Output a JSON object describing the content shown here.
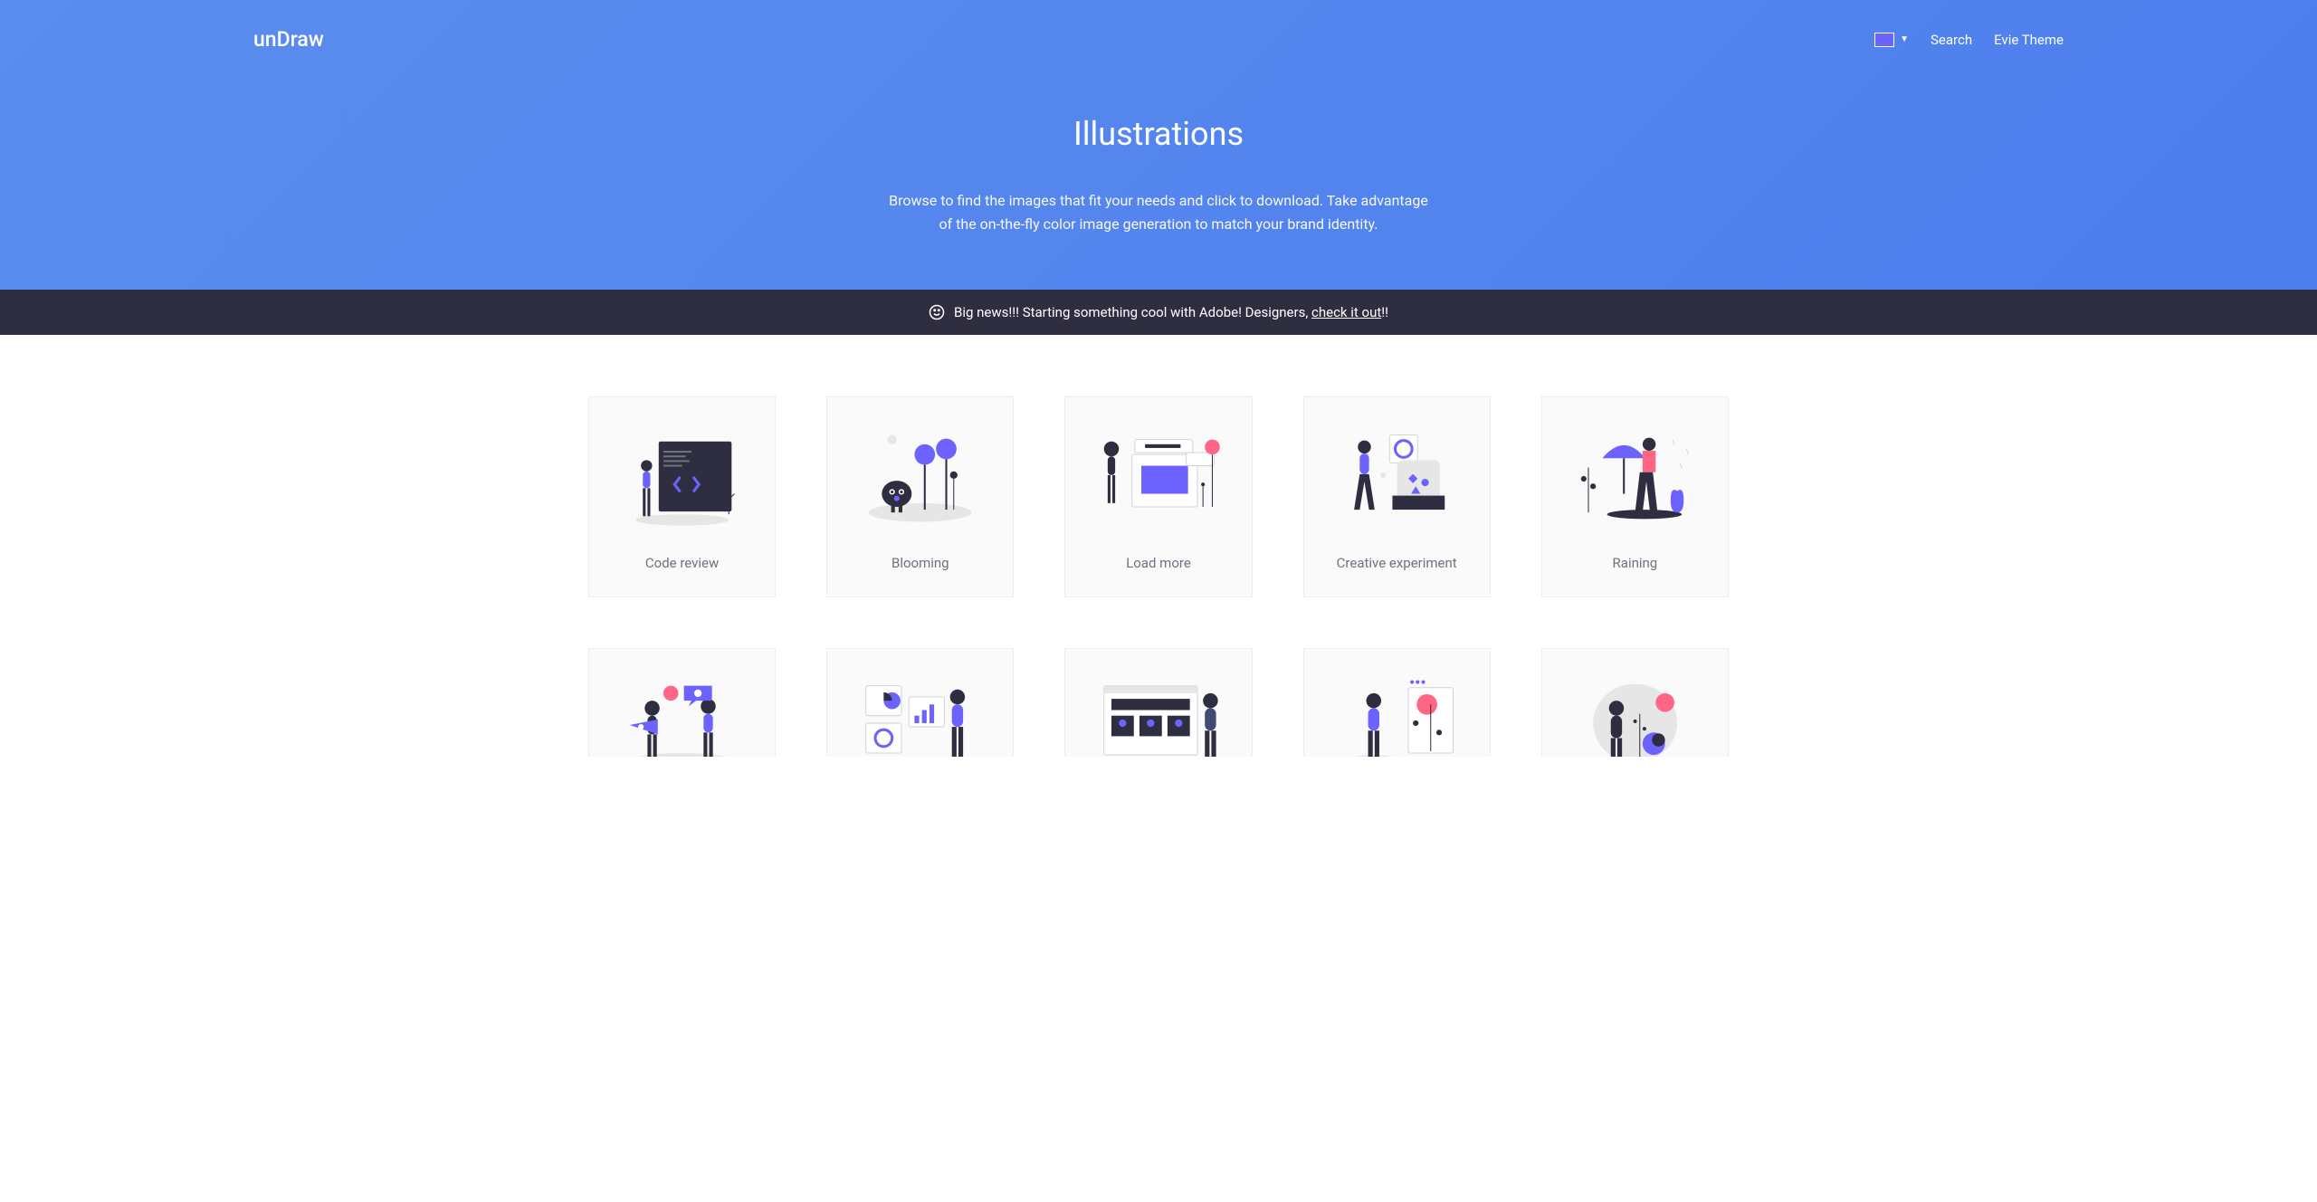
{
  "brand": "unDraw",
  "nav": {
    "search": "Search",
    "evie": "Evie Theme"
  },
  "hero": {
    "title": "Illustrations",
    "description": "Browse to find the images that fit your needs and click to download. Take advantage of the on-the-fly color image generation to match your brand identity."
  },
  "news": {
    "text_prefix": "Big news!!! Starting something cool with Adobe! Designers, ",
    "link_text": "check it out",
    "text_suffix": "!!"
  },
  "colors": {
    "accent": "#6c63ff"
  },
  "cards": {
    "row1": [
      {
        "title": "Code review"
      },
      {
        "title": "Blooming"
      },
      {
        "title": "Load more"
      },
      {
        "title": "Creative experiment"
      },
      {
        "title": "Raining"
      }
    ]
  }
}
